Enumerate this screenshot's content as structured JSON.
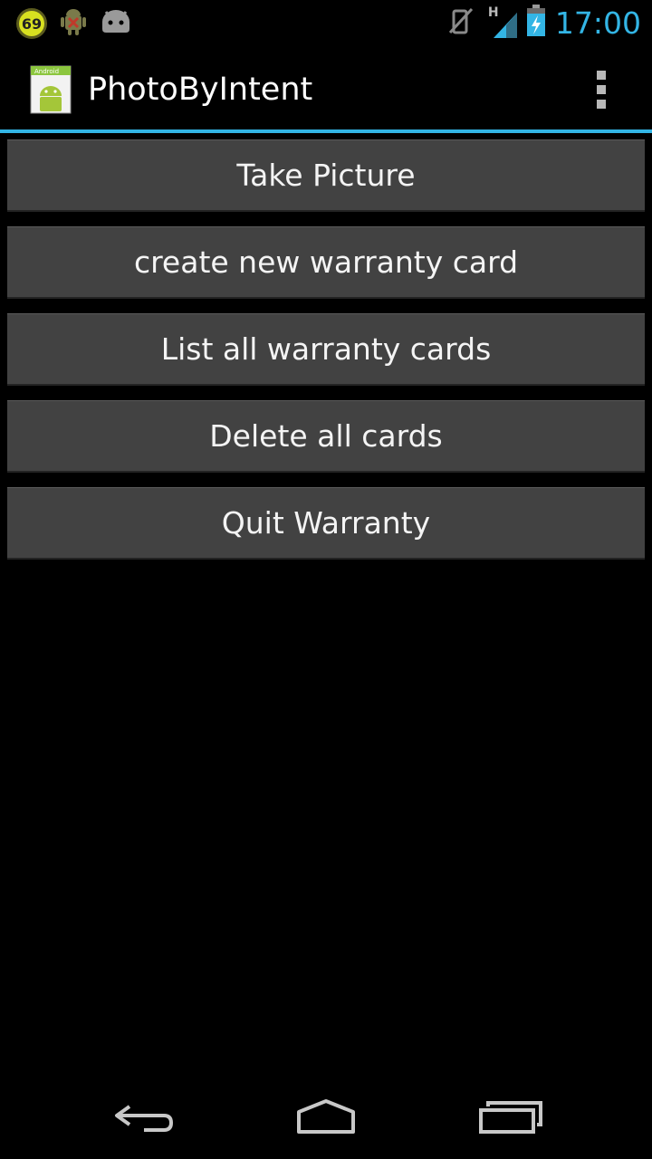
{
  "status_bar": {
    "notification_badge": "69",
    "network_type": "H",
    "time": "17:00",
    "icons": [
      "notification-count-icon",
      "android-debug-icon",
      "android-bot-icon",
      "mute-icon",
      "signal-icon",
      "battery-charging-icon"
    ]
  },
  "action_bar": {
    "title": "PhotoByIntent",
    "icon_label": "Android",
    "overflow_icon": "overflow-menu-icon"
  },
  "buttons": {
    "take_picture": "Take Picture",
    "create_card": "create new warranty card",
    "list_cards": "List all warranty cards",
    "delete_cards": "Delete all cards",
    "quit": "Quit Warranty"
  },
  "nav_bar": {
    "icons": [
      "back-icon",
      "home-icon",
      "recent-apps-icon"
    ]
  },
  "colors": {
    "accent": "#33b5e5",
    "button_bg": "#424242",
    "background": "#000000"
  }
}
